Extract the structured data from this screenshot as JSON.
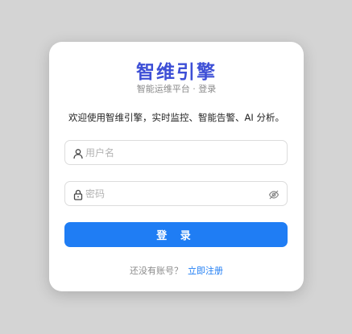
{
  "brand": {
    "title": "智维引擎",
    "subtitle": "智能运维平台 · 登录",
    "accent": "#3d4fd6"
  },
  "welcome": "欢迎使用智维引擎，实时监控、智能告警、AI 分析。",
  "form": {
    "username": {
      "value": "",
      "placeholder": "用户名",
      "icon": "user-icon"
    },
    "password": {
      "value": "",
      "placeholder": "密码",
      "icon": "lock-icon",
      "toggle_icon": "eye-off-icon"
    },
    "submit_label": "登 录",
    "submit_color": "#1f7df4"
  },
  "footer": {
    "prompt": "还没有账号？",
    "register_link": "立即注册"
  }
}
